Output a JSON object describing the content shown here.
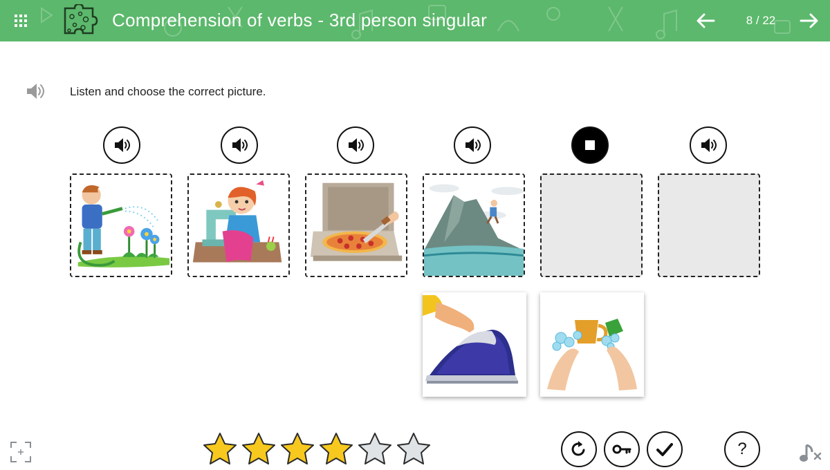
{
  "header": {
    "title": "Comprehension of verbs - 3rd person singular",
    "counter": "8 / 22",
    "menu_icon": "grid-menu-icon",
    "logo_icon": "puzzle-piece-icon",
    "prev_icon": "arrow-left-icon",
    "next_icon": "arrow-right-icon",
    "background_color": "#5cb86c"
  },
  "instruction": {
    "text": "Listen and choose the correct picture.",
    "icon": "speaker-icon"
  },
  "play_buttons": [
    {
      "icon": "speaker-icon",
      "state": "play"
    },
    {
      "icon": "speaker-icon",
      "state": "play"
    },
    {
      "icon": "speaker-icon",
      "state": "play"
    },
    {
      "icon": "speaker-icon",
      "state": "play"
    },
    {
      "icon": "stop-icon",
      "state": "playing"
    },
    {
      "icon": "speaker-icon",
      "state": "play"
    }
  ],
  "drop_slots": [
    {
      "content": "boy-watering-flowers",
      "filled": true
    },
    {
      "content": "girl-sewing",
      "filled": true
    },
    {
      "content": "cutting-pizza",
      "filled": true
    },
    {
      "content": "climbing-mountain",
      "filled": true
    },
    {
      "content": "",
      "filled": false
    },
    {
      "content": "",
      "filled": false
    }
  ],
  "answer_cards": [
    {
      "content": "ironing"
    },
    {
      "content": "washing-cup"
    }
  ],
  "stars": {
    "earned": 4,
    "total": 6,
    "earned_color": "#f7c81e",
    "empty_color": "#dfe3e6"
  },
  "controls": {
    "retry_icon": "retry-icon",
    "key_icon": "key-icon",
    "check_icon": "checkmark-icon",
    "help_label": "?",
    "fullscreen_icon": "fullscreen-icon",
    "music_icon": "music-off-icon"
  }
}
